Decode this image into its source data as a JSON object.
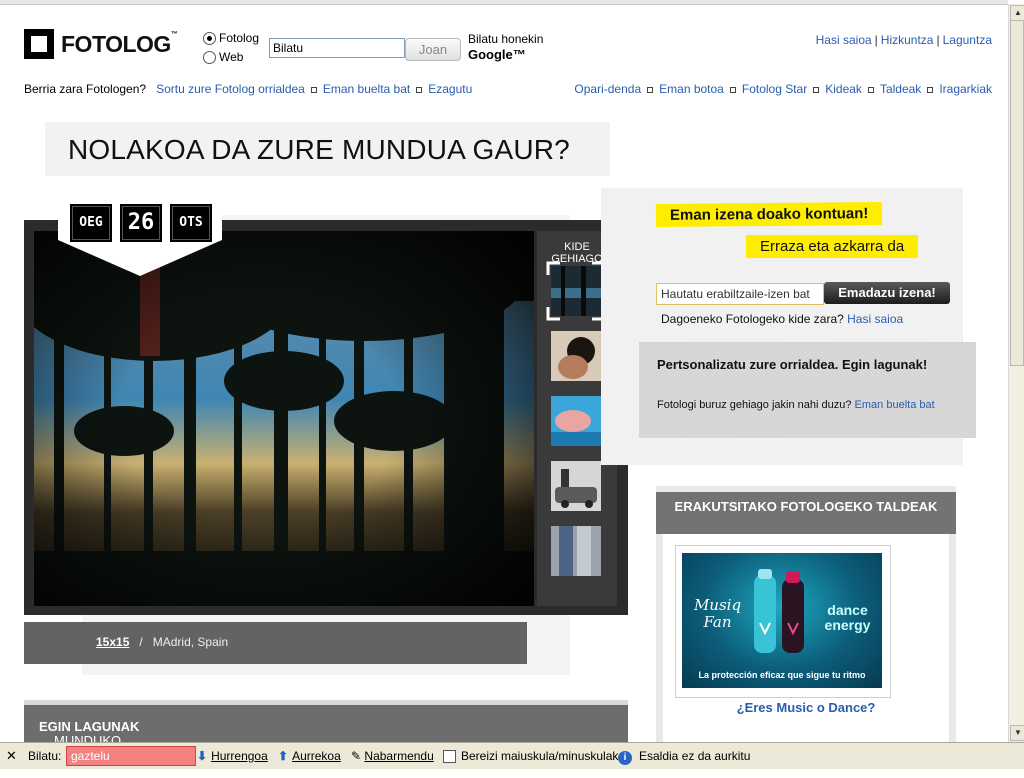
{
  "header": {
    "logo_text": "FOTOLOG",
    "logo_tm": "™",
    "search_options": [
      "Fotolog",
      "Web"
    ],
    "search_value": "Bilatu",
    "go_label": "Joan",
    "search_with": "Bilatu honekin",
    "google_label": "Google™",
    "top_links": [
      "Hasi saioa",
      "Hizkuntza",
      "Laguntza"
    ]
  },
  "subnav": {
    "intro": "Berria zara Fotologen?",
    "left_links": [
      "Sortu zure Fotolog orrialdea",
      "Eman buelta bat",
      "Ezagutu"
    ],
    "right_links": [
      "Opari-denda",
      "Eman botoa",
      "Fotolog Star",
      "Kideak",
      "Taldeak",
      "Iragarkiak"
    ]
  },
  "headline": "NOLAKOA DA ZURE MUNDUA GAUR?",
  "date_badge": {
    "weekday": "OEG",
    "day": "26",
    "month": "OTS"
  },
  "photo": {
    "more_members_label": "KIDE GEHIAGO",
    "caption_user": "15x15",
    "caption_sep": "/",
    "caption_location": "MAdrid, Spain"
  },
  "signup": {
    "headline1": "Eman izena doako kontuan!",
    "headline2": "Erraza eta azkarra da",
    "username_placeholder": "Hautatu erabiltzaile-izen bat",
    "button": "Emadazu izena!",
    "already_text": "Dagoeneko Fotologeko kide zara?",
    "already_link": "Hasi saioa"
  },
  "personalize": {
    "title": "Pertsonalizatu zure orrialdea. Egin lagunak!",
    "text": "Fotologi buruz gehiago jakin nahi duzu?",
    "link": "Eman buelta bat"
  },
  "groups": {
    "title": "ERAKUTSITAKO FOTOLOGEKO TALDEAK",
    "ad_left_text": "Musiq Fan",
    "ad_right_text": "dance energy",
    "ad_tagline": "La protección eficaz que sigue tu ritmo",
    "ad_link": "¿Eres Music o Dance?"
  },
  "join_bar": {
    "bold": "EGIN LAGUNAK",
    "rest": "MUNDUKO EDOZEIN TXOKOTAN"
  },
  "findbar": {
    "close": "✕",
    "label": "Bilatu:",
    "value": "gaztelu",
    "next": "Hurrengoa",
    "prev": "Aurrekoa",
    "highlight": "Nabarmendu",
    "match_case": "Bereizi maiuskula/minuskulak",
    "status": "Esaldia ez da aurkitu"
  }
}
